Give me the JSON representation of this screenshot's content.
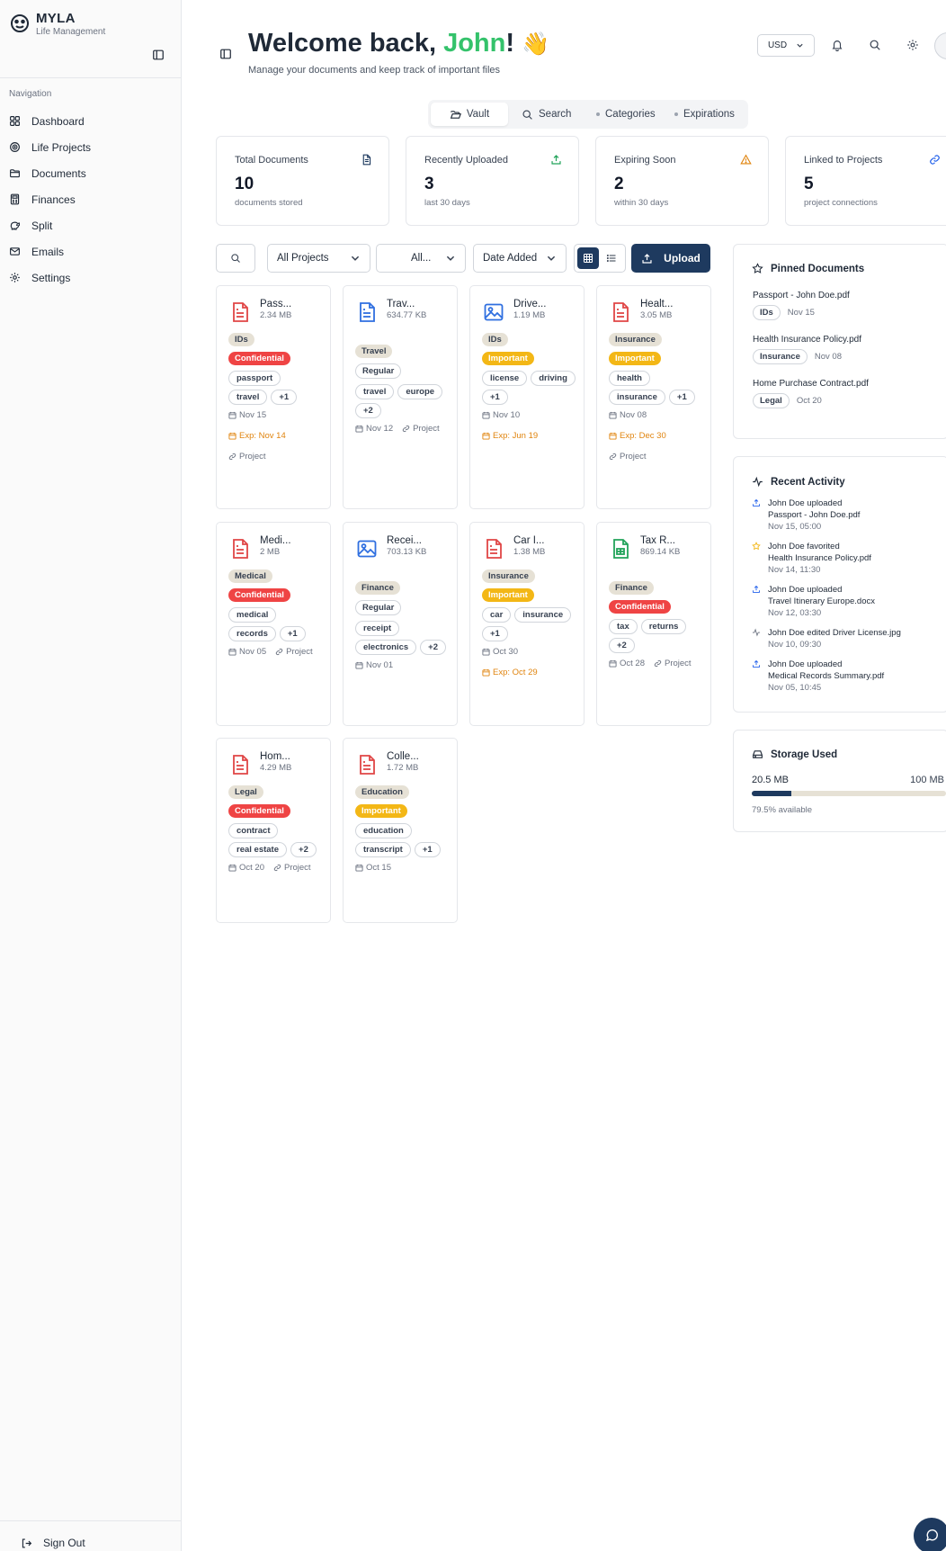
{
  "sidebar": {
    "brand_name": "MYLA",
    "brand_sub": "Life Management",
    "nav_heading": "Navigation",
    "items": [
      {
        "label": "Dashboard",
        "icon": "grid-icon"
      },
      {
        "label": "Life Projects",
        "icon": "target-icon"
      },
      {
        "label": "Documents",
        "icon": "folder-icon"
      },
      {
        "label": "Finances",
        "icon": "calculator-icon"
      },
      {
        "label": "Split",
        "icon": "piggy-bank-icon"
      },
      {
        "label": "Emails",
        "icon": "mail-icon"
      },
      {
        "label": "Settings",
        "icon": "gear-icon"
      }
    ],
    "sign_out": "Sign Out"
  },
  "header": {
    "welcome_prefix": "Welcome back, ",
    "user_name": "John",
    "welcome_suffix": "!",
    "wave": "👋",
    "subtitle": "Manage your documents and keep track of important files",
    "currency": "USD"
  },
  "tabs": [
    {
      "label": "Vault",
      "active": true
    },
    {
      "label": "Search",
      "active": false
    },
    {
      "label": "Categories",
      "active": false
    },
    {
      "label": "Expirations",
      "active": false
    }
  ],
  "stats": [
    {
      "label": "Total Documents",
      "value": "10",
      "sub": "documents stored",
      "icon": "document-icon",
      "color": "#1e3a5f"
    },
    {
      "label": "Recently Uploaded",
      "value": "3",
      "sub": "last 30 days",
      "icon": "upload-icon",
      "color": "#22a35a"
    },
    {
      "label": "Expiring Soon",
      "value": "2",
      "sub": "within 30 days",
      "icon": "warning-icon",
      "color": "#e0840e"
    },
    {
      "label": "Linked to Projects",
      "value": "5",
      "sub": "project connections",
      "icon": "link-icon",
      "color": "#2563eb"
    }
  ],
  "toolbar": {
    "project_filter": "All Projects",
    "type_filter": "All...",
    "sort": "Date Added",
    "upload": "Upload"
  },
  "documents": [
    {
      "title": "Pass...",
      "size": "2.34 MB",
      "icon": "pdf-icon",
      "category": "IDs",
      "status": "Confidential",
      "tags": [
        "passport",
        "travel",
        "+1"
      ],
      "date": "Nov 15",
      "exp": "Exp: Nov 14",
      "project": "Project"
    },
    {
      "title": "Trav...",
      "size": "634.77 KB",
      "icon": "doc-icon",
      "category": "Travel",
      "status": "Regular",
      "tags": [
        "travel",
        "europe",
        "+2"
      ],
      "date": "Nov 12",
      "exp": "",
      "project": "Project"
    },
    {
      "title": "Drive...",
      "size": "1.19 MB",
      "icon": "image-icon",
      "category": "IDs",
      "status": "Important",
      "tags": [
        "license",
        "driving",
        "+1"
      ],
      "date": "Nov 10",
      "exp": "Exp: Jun 19",
      "project": ""
    },
    {
      "title": "Healt...",
      "size": "3.05 MB",
      "icon": "pdf-icon",
      "category": "Insurance",
      "status": "Important",
      "tags": [
        "health",
        "insurance",
        "+1"
      ],
      "date": "Nov 08",
      "exp": "Exp: Dec 30",
      "project": "Project"
    },
    {
      "title": "Medi...",
      "size": "2 MB",
      "icon": "pdf-icon",
      "category": "Medical",
      "status": "Confidential",
      "tags": [
        "medical",
        "records",
        "+1"
      ],
      "date": "Nov 05",
      "exp": "",
      "project": "Project"
    },
    {
      "title": "Recei...",
      "size": "703.13 KB",
      "icon": "image-icon",
      "category": "Finance",
      "status": "Regular",
      "tags": [
        "receipt",
        "electronics",
        "+2"
      ],
      "date": "Nov 01",
      "exp": "",
      "project": ""
    },
    {
      "title": "Car I...",
      "size": "1.38 MB",
      "icon": "pdf-icon",
      "category": "Insurance",
      "status": "Important",
      "tags": [
        "car",
        "insurance",
        "+1"
      ],
      "date": "Oct 30",
      "exp": "Exp: Oct 29",
      "project": ""
    },
    {
      "title": "Tax R...",
      "size": "869.14 KB",
      "icon": "sheet-icon",
      "category": "Finance",
      "status": "Confidential",
      "tags": [
        "tax",
        "returns",
        "+2"
      ],
      "date": "Oct 28",
      "exp": "",
      "project": "Project"
    },
    {
      "title": "Hom...",
      "size": "4.29 MB",
      "icon": "pdf-icon",
      "category": "Legal",
      "status": "Confidential",
      "tags": [
        "contract",
        "real estate",
        "+2"
      ],
      "date": "Oct 20",
      "exp": "",
      "project": "Project"
    },
    {
      "title": "Colle...",
      "size": "1.72 MB",
      "icon": "pdf-icon",
      "category": "Education",
      "status": "Important",
      "tags": [
        "education",
        "transcript",
        "+1"
      ],
      "date": "Oct 15",
      "exp": "",
      "project": ""
    }
  ],
  "pinned": {
    "title": "Pinned Documents",
    "items": [
      {
        "name": "Passport - John Doe.pdf",
        "category": "IDs",
        "date": "Nov 15"
      },
      {
        "name": "Health Insurance Policy.pdf",
        "category": "Insurance",
        "date": "Nov 08"
      },
      {
        "name": "Home Purchase Contract.pdf",
        "category": "Legal",
        "date": "Oct 20"
      }
    ]
  },
  "activity": {
    "title": "Recent Activity",
    "items": [
      {
        "icon": "upload-icon",
        "text": "John Doe uploaded",
        "file": "Passport - John Doe.pdf",
        "time": "Nov 15, 05:00"
      },
      {
        "icon": "star-icon",
        "text": "John Doe favorited",
        "file": "Health Insurance Policy.pdf",
        "time": "Nov 14, 11:30"
      },
      {
        "icon": "upload-icon",
        "text": "John Doe uploaded",
        "file": "Travel Itinerary Europe.docx",
        "time": "Nov 12, 03:30"
      },
      {
        "icon": "activity-icon",
        "text": "John Doe edited Driver License.jpg",
        "file": "",
        "time": "Nov 10, 09:30"
      },
      {
        "icon": "upload-icon",
        "text": "John Doe uploaded",
        "file": "Medical Records Summary.pdf",
        "time": "Nov 05, 10:45"
      }
    ]
  },
  "storage": {
    "title": "Storage Used",
    "used": "20.5 MB",
    "total": "100 MB",
    "available": "79.5% available",
    "used_fraction": 0.205
  }
}
